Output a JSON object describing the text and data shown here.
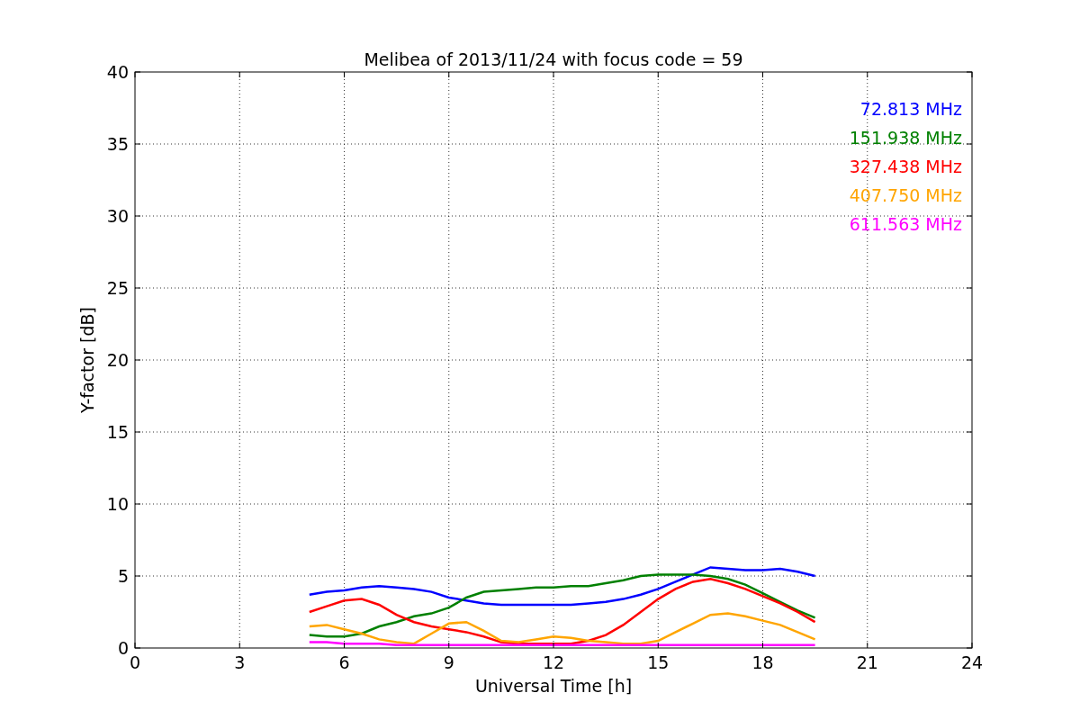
{
  "figure": {
    "chart_data": {
      "type": "line",
      "title": "Melibea of 2013/11/24 with focus code = 59",
      "xlabel": "Universal Time [h]",
      "ylabel": "Y-factor [dB]",
      "x": [
        5,
        5.5,
        6,
        6.5,
        7,
        7.5,
        8,
        8.5,
        9,
        9.5,
        10,
        10.5,
        11,
        11.5,
        12,
        12.5,
        13,
        13.5,
        14,
        14.5,
        15,
        15.5,
        16,
        16.5,
        17,
        17.5,
        18,
        18.5,
        19,
        19.5
      ],
      "series": [
        {
          "name": "72.813 MHz",
          "color": "#0000ff",
          "values": [
            3.7,
            3.9,
            4.0,
            4.2,
            4.3,
            4.2,
            4.1,
            3.9,
            3.5,
            3.3,
            3.1,
            3.0,
            3.0,
            3.0,
            3.0,
            3.0,
            3.1,
            3.2,
            3.4,
            3.7,
            4.1,
            4.6,
            5.1,
            5.6,
            5.5,
            5.4,
            5.4,
            5.5,
            5.3,
            5.0
          ]
        },
        {
          "name": "151.938 MHz",
          "color": "#008000",
          "values": [
            0.9,
            0.8,
            0.8,
            1.0,
            1.5,
            1.8,
            2.2,
            2.4,
            2.8,
            3.5,
            3.9,
            4.0,
            4.1,
            4.2,
            4.2,
            4.3,
            4.3,
            4.5,
            4.7,
            5.0,
            5.1,
            5.1,
            5.1,
            5.0,
            4.8,
            4.4,
            3.8,
            3.2,
            2.6,
            2.1
          ]
        },
        {
          "name": "327.438 MHz",
          "color": "#ff0000",
          "values": [
            2.5,
            2.9,
            3.3,
            3.4,
            3.0,
            2.3,
            1.8,
            1.5,
            1.3,
            1.1,
            0.8,
            0.4,
            0.3,
            0.3,
            0.3,
            0.3,
            0.5,
            0.9,
            1.6,
            2.5,
            3.4,
            4.1,
            4.6,
            4.8,
            4.5,
            4.1,
            3.6,
            3.1,
            2.5,
            1.8
          ]
        },
        {
          "name": "407.750 MHz",
          "color": "#ffa500",
          "values": [
            1.5,
            1.6,
            1.3,
            1.0,
            0.6,
            0.4,
            0.3,
            1.0,
            1.7,
            1.8,
            1.2,
            0.5,
            0.4,
            0.6,
            0.8,
            0.7,
            0.5,
            0.4,
            0.3,
            0.3,
            0.5,
            1.1,
            1.7,
            2.3,
            2.4,
            2.2,
            1.9,
            1.6,
            1.1,
            0.6
          ]
        },
        {
          "name": "611.563 MHz",
          "color": "#ff00ff",
          "values": [
            0.4,
            0.4,
            0.3,
            0.3,
            0.3,
            0.2,
            0.2,
            0.2,
            0.2,
            0.2,
            0.2,
            0.2,
            0.2,
            0.2,
            0.2,
            0.2,
            0.2,
            0.2,
            0.2,
            0.2,
            0.2,
            0.2,
            0.2,
            0.2,
            0.2,
            0.2,
            0.2,
            0.2,
            0.2,
            0.2
          ]
        }
      ],
      "xlim": [
        0,
        24
      ],
      "ylim": [
        0,
        40
      ],
      "grid": true,
      "xticks": [
        0,
        3,
        6,
        9,
        12,
        15,
        18,
        21,
        24
      ],
      "yticks": [
        0,
        5,
        10,
        15,
        20,
        25,
        30,
        35,
        40
      ]
    }
  }
}
